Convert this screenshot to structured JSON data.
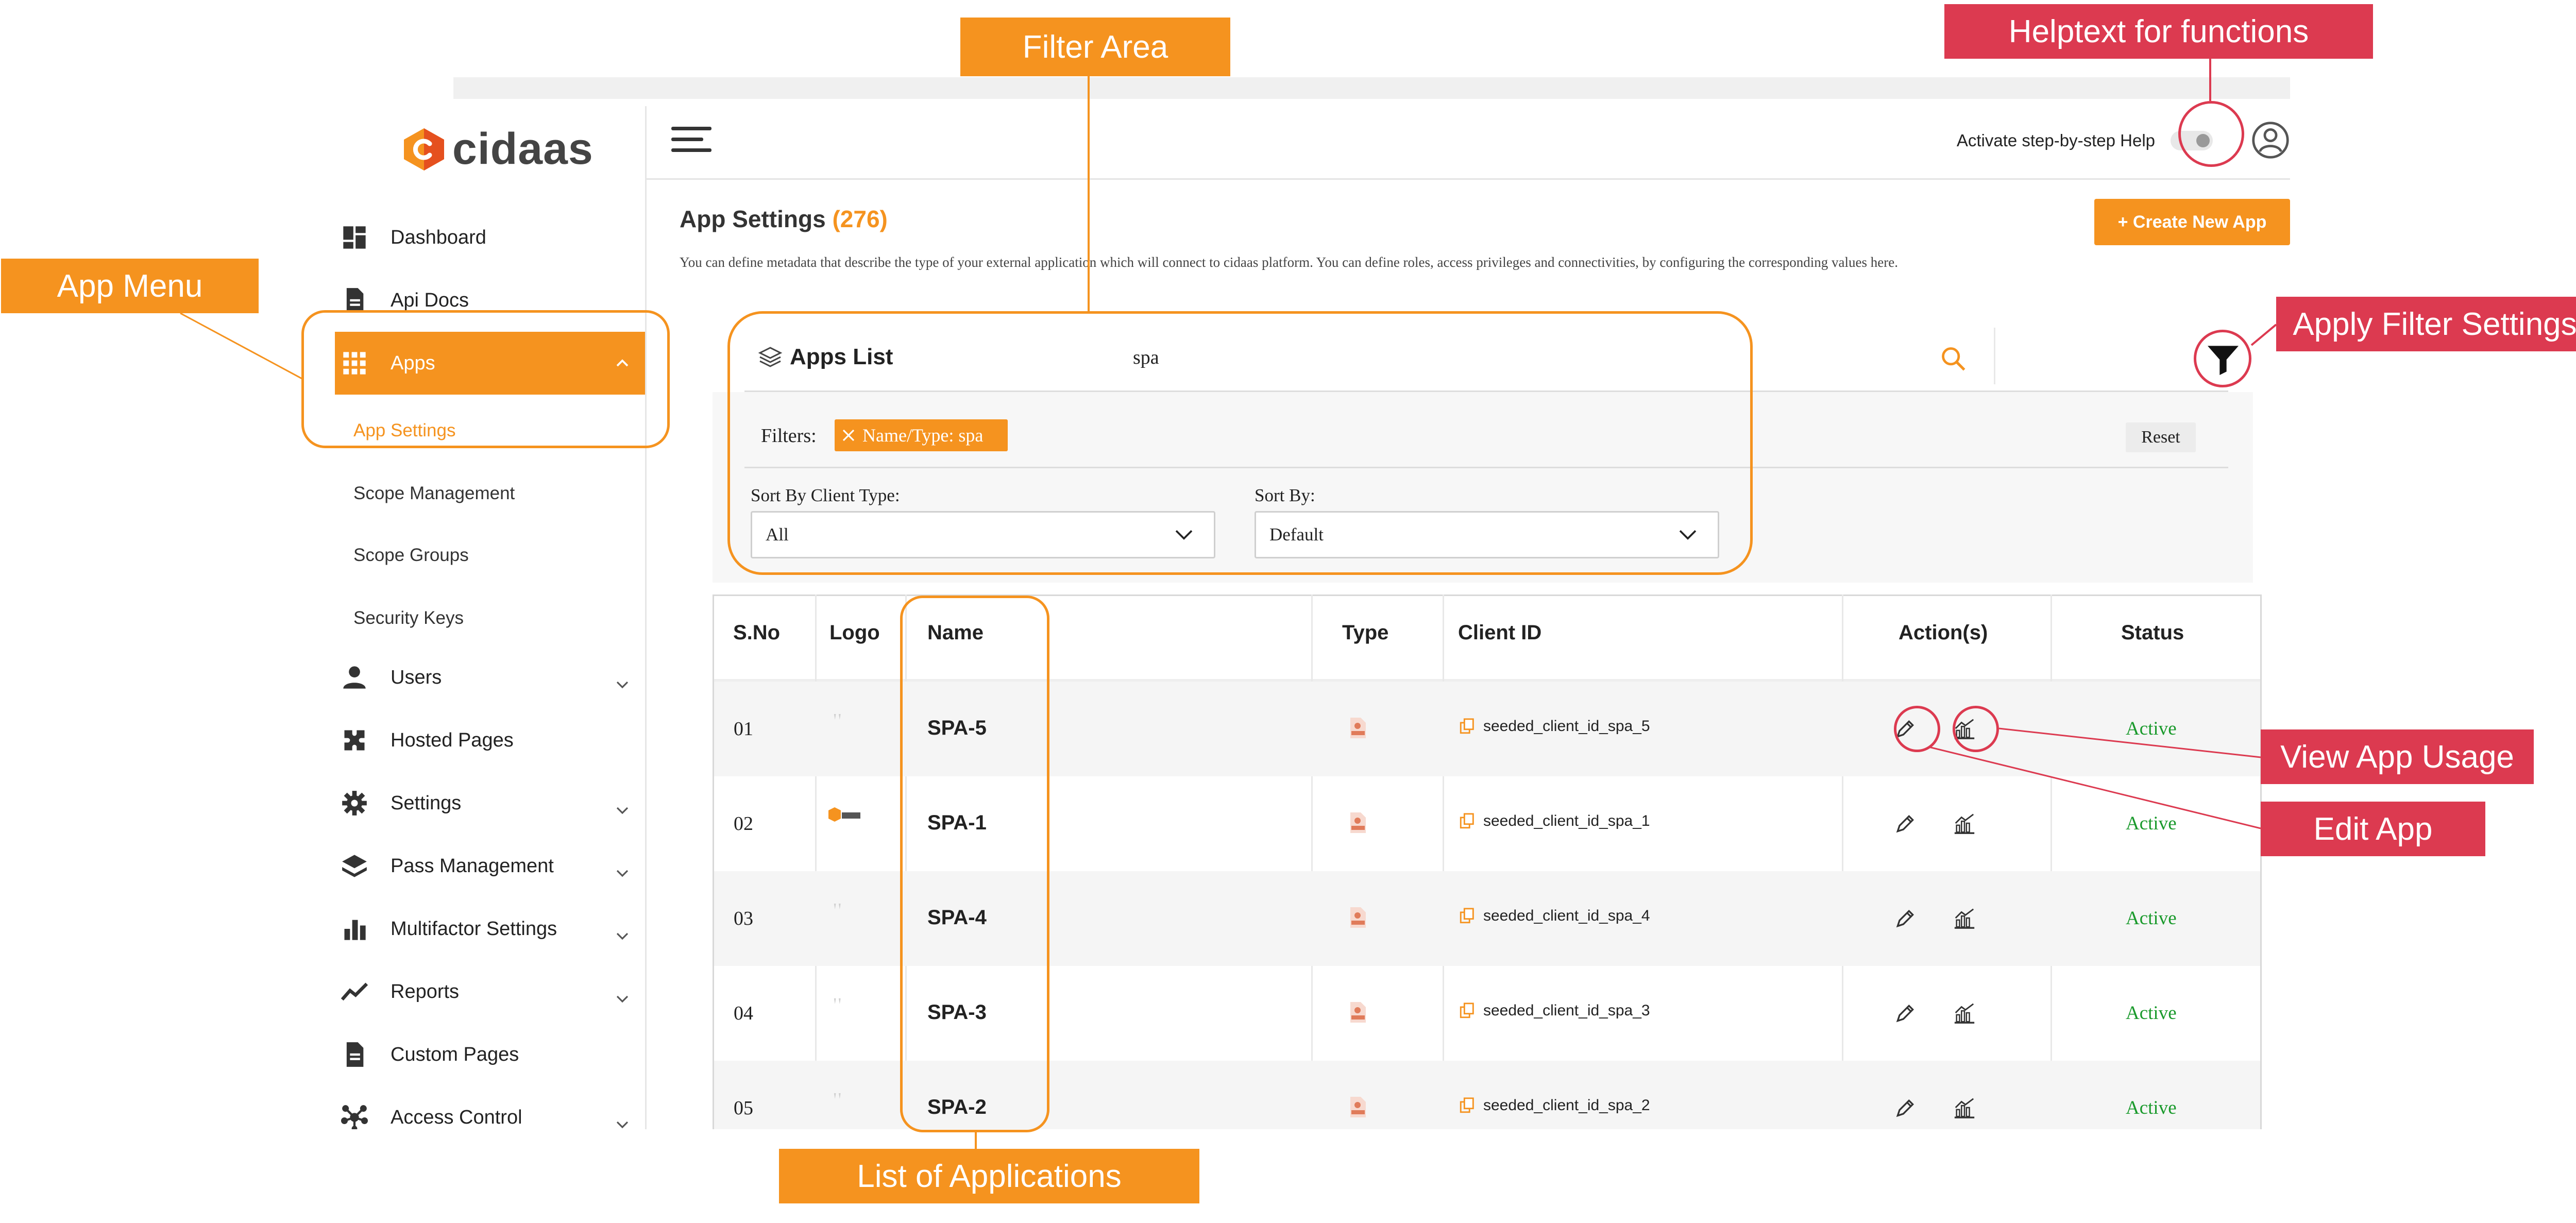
{
  "annotations": {
    "filter_area": "Filter Area",
    "helptext": "Helptext for functions",
    "app_menu": "App Menu",
    "apply_filter": "Apply Filter Settings",
    "view_usage": "View App Usage",
    "edit_app": "Edit App",
    "list_apps": "List of Applications"
  },
  "brand": {
    "name": "cidaas",
    "accent": "#f5931f",
    "annotation_red": "#dc3a50"
  },
  "sidebar": {
    "items": [
      {
        "label": "Dashboard",
        "icon": "dashboard-icon"
      },
      {
        "label": "Api Docs",
        "icon": "document-icon"
      },
      {
        "label": "Apps",
        "icon": "apps-grid-icon"
      },
      {
        "label": "Users",
        "icon": "user-icon"
      },
      {
        "label": "Hosted Pages",
        "icon": "puzzle-icon"
      },
      {
        "label": "Settings",
        "icon": "gear-icon"
      },
      {
        "label": "Pass Management",
        "icon": "layers-icon"
      },
      {
        "label": "Multifactor Settings",
        "icon": "bar-chart-icon"
      },
      {
        "label": "Reports",
        "icon": "trend-icon"
      },
      {
        "label": "Custom Pages",
        "icon": "document-icon"
      },
      {
        "label": "Access Control",
        "icon": "network-icon"
      }
    ],
    "apps_sub": [
      "App Settings",
      "Scope Management",
      "Scope Groups",
      "Security Keys"
    ]
  },
  "header": {
    "help_label": "Activate step-by-step Help"
  },
  "page": {
    "title": "App Settings",
    "count": "(276)",
    "description": "You can define metadata that describe the type of your external application which will connect to cidaas platform. You can define roles, access privileges and connectivities, by configuring the corresponding values here.",
    "create_button": "+ Create New App"
  },
  "list": {
    "title": "Apps List",
    "search_value": "spa",
    "filters_label": "Filters:",
    "chip": "Name/Type: spa",
    "reset": "Reset",
    "sort_client_label": "Sort By Client Type:",
    "sort_client_value": "All",
    "sort_by_label": "Sort By:",
    "sort_by_value": "Default"
  },
  "table": {
    "headers": [
      "S.No",
      "Logo",
      "Name",
      "Type",
      "Client ID",
      "Action(s)",
      "Status"
    ],
    "rows": [
      {
        "sno": "01",
        "name": "SPA-5",
        "client_id": "seeded_client_id_spa_5",
        "status": "Active"
      },
      {
        "sno": "02",
        "name": "SPA-1",
        "client_id": "seeded_client_id_spa_1",
        "status": "Active"
      },
      {
        "sno": "03",
        "name": "SPA-4",
        "client_id": "seeded_client_id_spa_4",
        "status": "Active"
      },
      {
        "sno": "04",
        "name": "SPA-3",
        "client_id": "seeded_client_id_spa_3",
        "status": "Active"
      },
      {
        "sno": "05",
        "name": "SPA-2",
        "client_id": "seeded_client_id_spa_2",
        "status": "Active"
      }
    ]
  }
}
